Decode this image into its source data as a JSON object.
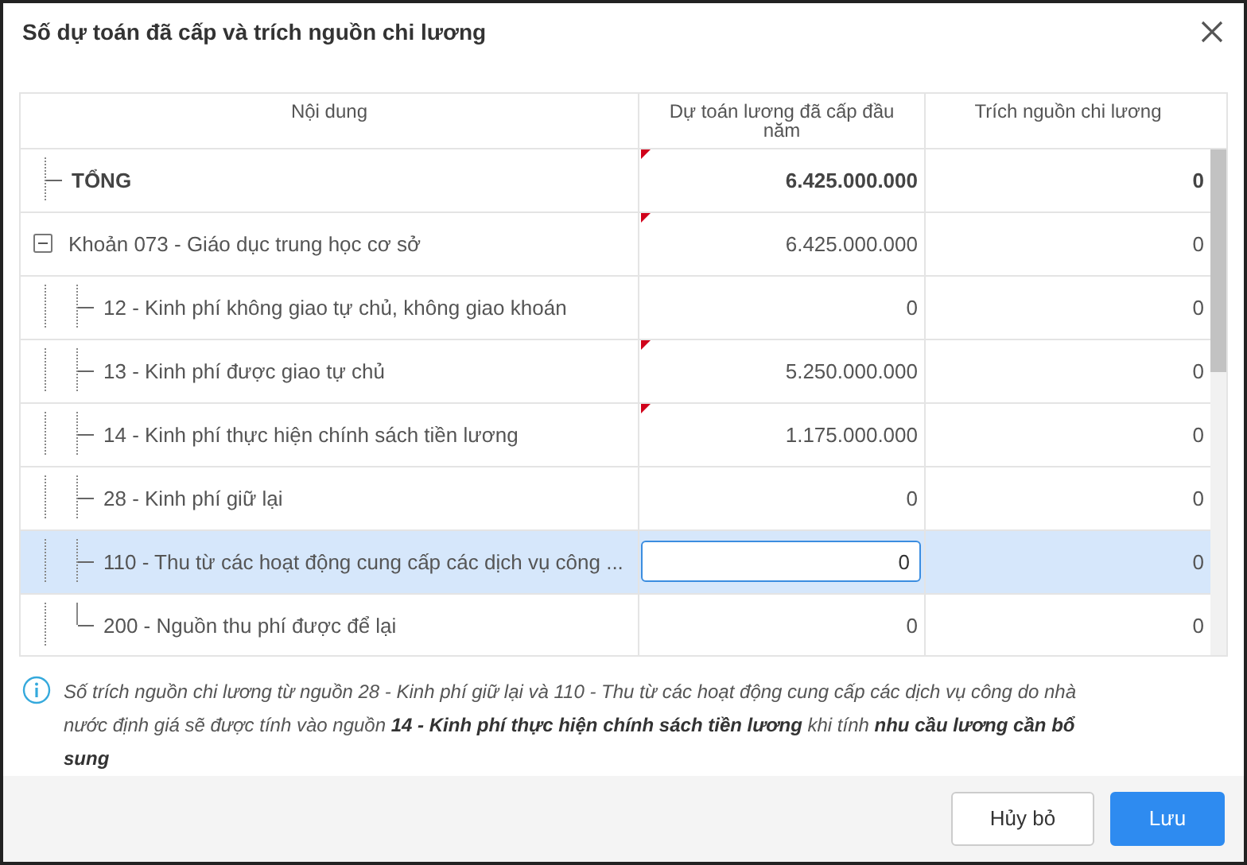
{
  "dialog": {
    "title": "Số dự toán đã cấp và trích nguồn chi lương"
  },
  "table": {
    "columns": [
      "Nội dung",
      "Dự toán lương đã cấp đầu năm",
      "Trích nguồn chi lương"
    ],
    "rows": [
      {
        "kind": "total",
        "label": "TỔNG",
        "budget": "6.425.000.000",
        "extract": "0",
        "flagged": true,
        "selected": false
      },
      {
        "kind": "group",
        "label": "Khoản 073 - Giáo dục trung học cơ sở",
        "budget": "6.425.000.000",
        "extract": "0",
        "flagged": true,
        "selected": false,
        "expanded": true,
        "children": [
          {
            "kind": "leaf",
            "label": "12 - Kinh phí không giao tự chủ, không giao khoán",
            "budget": "0",
            "extract": "0",
            "flagged": false,
            "selected": false
          },
          {
            "kind": "leaf",
            "label": "13 - Kinh phí được giao tự chủ",
            "budget": "5.250.000.000",
            "extract": "0",
            "flagged": true,
            "selected": false
          },
          {
            "kind": "leaf",
            "label": "14 - Kinh phí thực hiện chính sách tiền lương",
            "budget": "1.175.000.000",
            "extract": "0",
            "flagged": true,
            "selected": false
          },
          {
            "kind": "leaf",
            "label": "28 - Kinh phí giữ lại",
            "budget": "0",
            "extract": "0",
            "flagged": false,
            "selected": false
          },
          {
            "kind": "leaf",
            "label": "110 - Thu từ các hoạt động cung cấp các dịch vụ công ...",
            "budget": "0",
            "extract": "0",
            "flagged": false,
            "selected": true
          },
          {
            "kind": "leaf",
            "label": "200 - Nguồn thu phí được để lại",
            "budget": "0",
            "extract": "0",
            "flagged": false,
            "selected": false
          }
        ]
      }
    ]
  },
  "note": "Số trích nguồn chi lương từ nguồn 28 - Kinh phí giữ lại và 110 - Thu từ các hoạt động cung cấp các dịch vụ công do nhà nước định giá sẽ được tính vào nguồn **14 - Kinh phí thực hiện chính sách tiền lương** khi tính **nhu cầu lương cần bổ sung**",
  "buttons": [
    {
      "kind": "secondary",
      "label": "Hủy bỏ"
    },
    {
      "kind": "primary",
      "label": "Lưu"
    }
  ]
}
